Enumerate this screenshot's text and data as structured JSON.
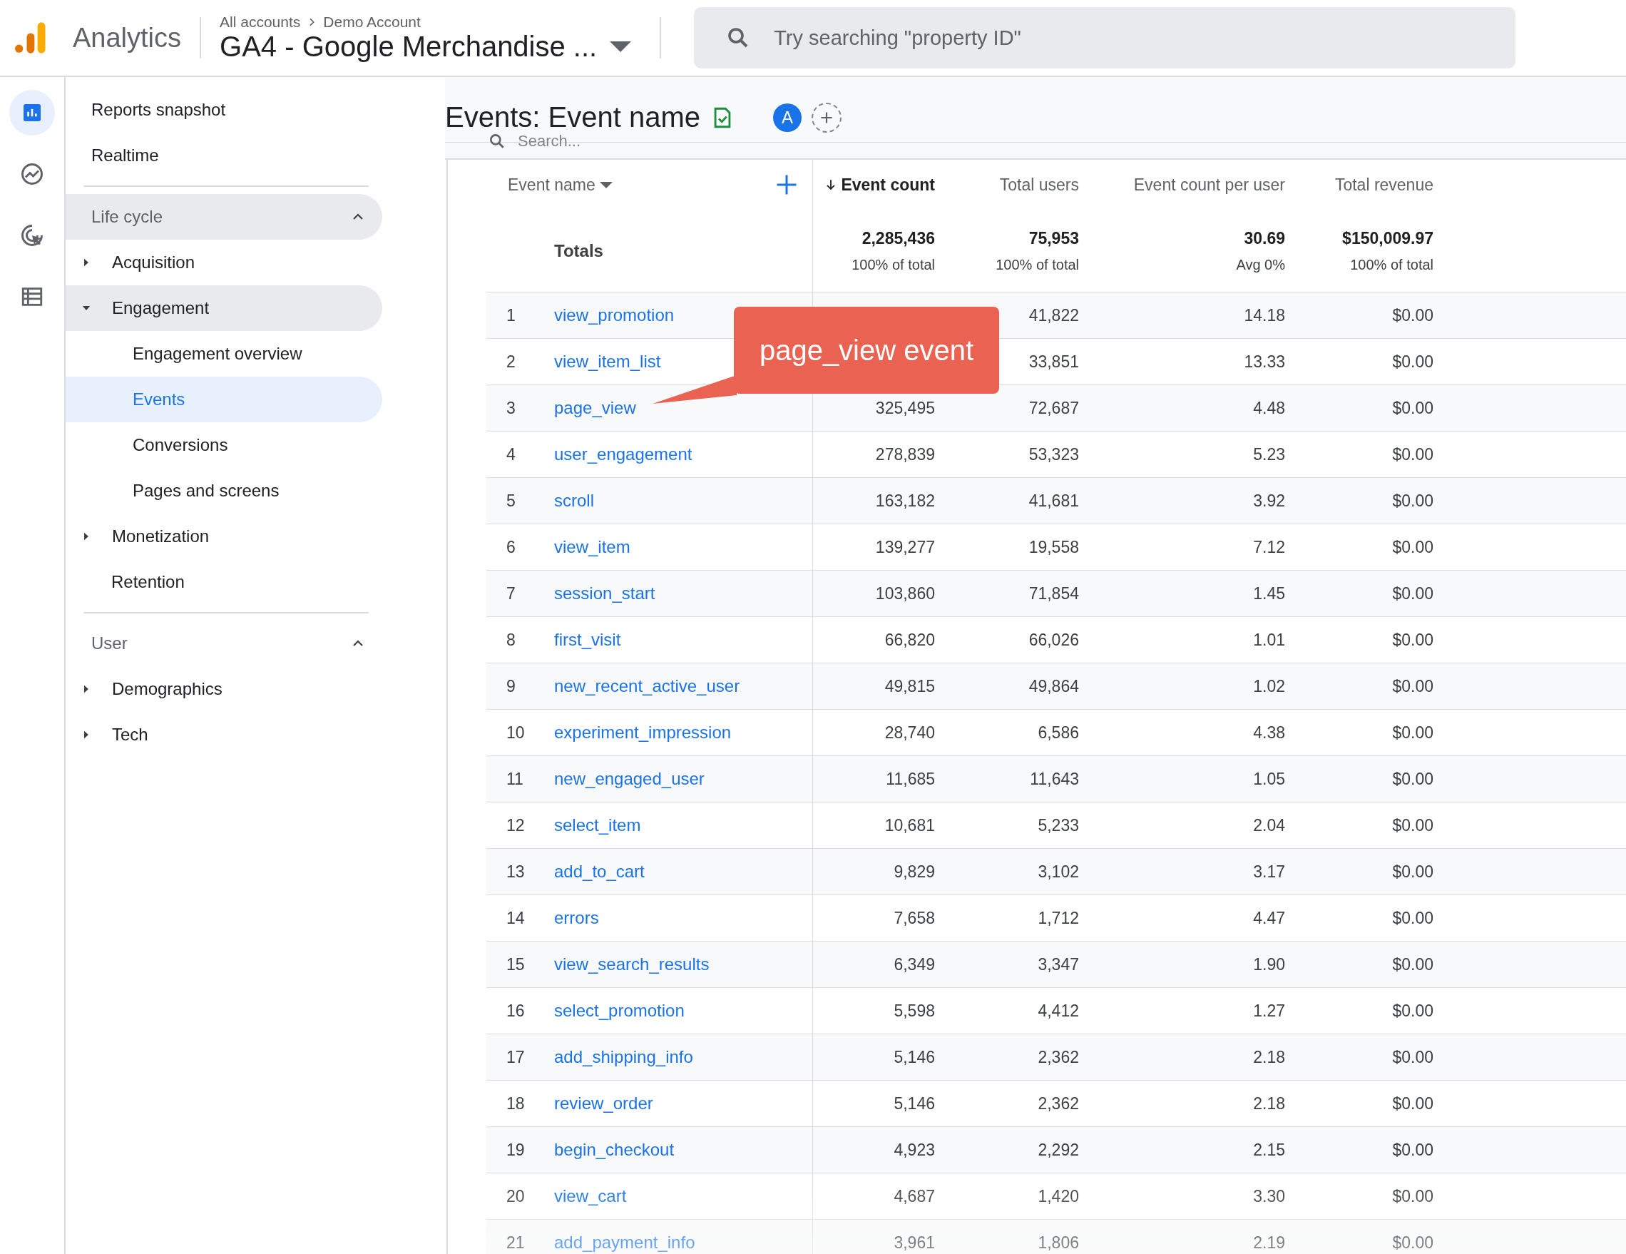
{
  "header": {
    "product": "Analytics",
    "breadcrumb": [
      "All accounts",
      "Demo Account"
    ],
    "property": "GA4 - Google Merchandise ...",
    "search_placeholder": "Try searching \"property ID\""
  },
  "rail": [
    {
      "kind": "reports",
      "selected": true
    },
    {
      "kind": "explore",
      "selected": false
    },
    {
      "kind": "advertising",
      "selected": false
    },
    {
      "kind": "configure",
      "selected": false
    }
  ],
  "sidebar": {
    "top": [
      {
        "label": "Reports snapshot",
        "selected": false
      },
      {
        "label": "Realtime",
        "selected": false
      }
    ],
    "sections": [
      {
        "title": "Life cycle",
        "expanded": true,
        "active": true,
        "items": [
          {
            "kind": "group",
            "label": "Acquisition",
            "expanded": false,
            "active": false
          },
          {
            "kind": "group",
            "label": "Engagement",
            "expanded": true,
            "active": true,
            "children": [
              {
                "label": "Engagement overview",
                "selected": false
              },
              {
                "label": "Events",
                "selected": true
              },
              {
                "label": "Conversions",
                "selected": false
              },
              {
                "label": "Pages and screens",
                "selected": false
              }
            ]
          },
          {
            "kind": "group",
            "label": "Monetization",
            "expanded": false,
            "active": false
          },
          {
            "kind": "page",
            "label": "Retention",
            "selected": false
          }
        ]
      },
      {
        "title": "User",
        "expanded": true,
        "active": false,
        "items": [
          {
            "kind": "group",
            "label": "Demographics",
            "expanded": false,
            "active": false
          },
          {
            "kind": "group",
            "label": "Tech",
            "expanded": false,
            "active": false
          }
        ]
      }
    ]
  },
  "report": {
    "title": "Events: Event name",
    "avatar": "A",
    "search_placeholder": "Search..."
  },
  "table": {
    "dimension": "Event name",
    "columns": [
      {
        "label": "Event count",
        "sorted": true
      },
      {
        "label": "Total users",
        "sorted": false
      },
      {
        "label": "Event count per user",
        "sorted": false
      },
      {
        "label": "Total revenue",
        "sorted": false
      }
    ],
    "totals": {
      "label": "Totals",
      "values": [
        {
          "value": "2,285,436",
          "note": "100% of total"
        },
        {
          "value": "75,953",
          "note": "100% of total"
        },
        {
          "value": "30.69",
          "note": "Avg 0%"
        },
        {
          "value": "$150,009.97",
          "note": "100% of total"
        }
      ]
    },
    "rows": [
      {
        "index": "1",
        "name": "view_promotion",
        "others": [
          "41,822",
          "14.18",
          "$0.00"
        ]
      },
      {
        "index": "2",
        "name": "view_item_list",
        "others": [
          "33,851",
          "13.33",
          "$0.00"
        ]
      },
      {
        "index": "3",
        "name": "page_view",
        "event_count": "325,495",
        "others": [
          "72,687",
          "4.48",
          "$0.00"
        ]
      },
      {
        "index": "4",
        "name": "user_engagement",
        "event_count": "278,839",
        "others": [
          "53,323",
          "5.23",
          "$0.00"
        ]
      },
      {
        "index": "5",
        "name": "scroll",
        "event_count": "163,182",
        "others": [
          "41,681",
          "3.92",
          "$0.00"
        ]
      },
      {
        "index": "6",
        "name": "view_item",
        "event_count": "139,277",
        "others": [
          "19,558",
          "7.12",
          "$0.00"
        ]
      },
      {
        "index": "7",
        "name": "session_start",
        "event_count": "103,860",
        "others": [
          "71,854",
          "1.45",
          "$0.00"
        ]
      },
      {
        "index": "8",
        "name": "first_visit",
        "event_count": "66,820",
        "others": [
          "66,026",
          "1.01",
          "$0.00"
        ]
      },
      {
        "index": "9",
        "name": "new_recent_active_user",
        "event_count": "49,815",
        "others": [
          "49,864",
          "1.02",
          "$0.00"
        ]
      },
      {
        "index": "10",
        "name": "experiment_impression",
        "event_count": "28,740",
        "others": [
          "6,586",
          "4.38",
          "$0.00"
        ]
      },
      {
        "index": "11",
        "name": "new_engaged_user",
        "event_count": "11,685",
        "others": [
          "11,643",
          "1.05",
          "$0.00"
        ]
      },
      {
        "index": "12",
        "name": "select_item",
        "event_count": "10,681",
        "others": [
          "5,233",
          "2.04",
          "$0.00"
        ]
      },
      {
        "index": "13",
        "name": "add_to_cart",
        "event_count": "9,829",
        "others": [
          "3,102",
          "3.17",
          "$0.00"
        ]
      },
      {
        "index": "14",
        "name": "errors",
        "event_count": "7,658",
        "others": [
          "1,712",
          "4.47",
          "$0.00"
        ]
      },
      {
        "index": "15",
        "name": "view_search_results",
        "event_count": "6,349",
        "others": [
          "3,347",
          "1.90",
          "$0.00"
        ]
      },
      {
        "index": "16",
        "name": "select_promotion",
        "event_count": "5,598",
        "others": [
          "4,412",
          "1.27",
          "$0.00"
        ]
      },
      {
        "index": "17",
        "name": "add_shipping_info",
        "event_count": "5,146",
        "others": [
          "2,362",
          "2.18",
          "$0.00"
        ]
      },
      {
        "index": "18",
        "name": "review_order",
        "event_count": "5,146",
        "others": [
          "2,362",
          "2.18",
          "$0.00"
        ]
      },
      {
        "index": "19",
        "name": "begin_checkout",
        "event_count": "4,923",
        "others": [
          "2,292",
          "2.15",
          "$0.00"
        ]
      },
      {
        "index": "20",
        "name": "view_cart",
        "event_count": "4,687",
        "others": [
          "1,420",
          "3.30",
          "$0.00"
        ]
      },
      {
        "index": "21",
        "name": "add_payment_info",
        "event_count": "3,961",
        "others": [
          "1,806",
          "2.19",
          "$0.00"
        ]
      }
    ]
  },
  "callout": {
    "text": "page_view event"
  }
}
